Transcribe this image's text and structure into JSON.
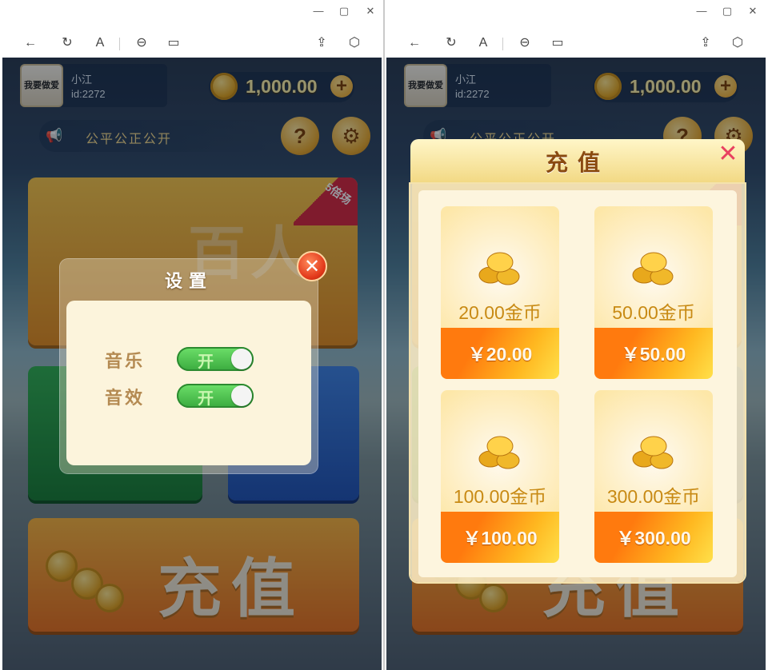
{
  "window_controls": {
    "minimize": "—",
    "maximize": "▢",
    "close": "✕"
  },
  "toolbar_icons": [
    "back-icon",
    "refresh-icon",
    "font-icon",
    "link-icon",
    "window-icon",
    "share-icon",
    "cube-icon"
  ],
  "profile": {
    "avatar_text": "我要做爱",
    "name": "小江",
    "id": "id:2272"
  },
  "balance": {
    "amount": "1,000.00",
    "plus": "+"
  },
  "notice": {
    "text": "公平公正公开"
  },
  "help_label": "?",
  "left": {
    "room_badge": "5倍场",
    "room_title": "百人",
    "recharge_banner": "充值",
    "settings": {
      "title": "设置",
      "close": "✕",
      "music_label": "音乐",
      "music_state": "开",
      "sfx_label": "音效",
      "sfx_state": "开"
    }
  },
  "right": {
    "recharge_banner": "充值",
    "recharge": {
      "title": "充值",
      "close": "✕",
      "packages": [
        {
          "coins": "20.00金币",
          "price": "￥20.00"
        },
        {
          "coins": "50.00金币",
          "price": "￥50.00"
        },
        {
          "coins": "100.00金币",
          "price": "￥100.00"
        },
        {
          "coins": "300.00金币",
          "price": "￥300.00"
        }
      ]
    }
  }
}
